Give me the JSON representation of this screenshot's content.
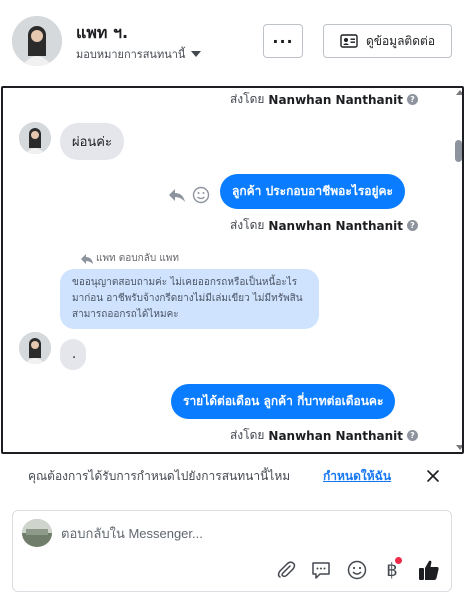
{
  "header": {
    "contact_name": "แพท ฯ.",
    "assign_label": "มอบหมายการสนทนานี้",
    "more_label": "···",
    "contact_info_label": "ดูข้อมูลติดต่อ"
  },
  "conversation": {
    "sent_by_prefix": "ส่งโดย",
    "sender_name": "Nanwhan Nanthanit",
    "help_mark": "?",
    "incoming_1": "ผ่อนค่ะ",
    "outgoing_1": "ลูกค้า ประกอบอาชีพอะไรอยู่คะ",
    "reply_label": "แพท ตอบกลับ แพท",
    "quoted_reply": "ขออนุญาตสอบถามค่ะ ไม่เคยออกรถหรือเป็นหนี้อะไรมาก่อน อาชีพรับจ้างกรีดยางไม่มีเล่มเขียว ไม่มีทรัพสิน สามารถออกรถได้ไหมคะ",
    "incoming_2": ".",
    "outgoing_2": "รายได้ต่อเดือน ลูกค้า  กี่บาทต่อเดือนคะ"
  },
  "assign_banner": {
    "text": "คุณต้องการได้รับการกำหนดไปยังการสนทนานี้ไหม",
    "link": "กำหนดให้ฉัน"
  },
  "composer": {
    "placeholder": "ตอบกลับใน Messenger...",
    "currency_symbol": "฿"
  },
  "colors": {
    "accent": "#0a7cff",
    "link": "#1877f2",
    "quote_bubble": "#cfe3ff",
    "incoming_bubble": "#e4e6eb"
  }
}
